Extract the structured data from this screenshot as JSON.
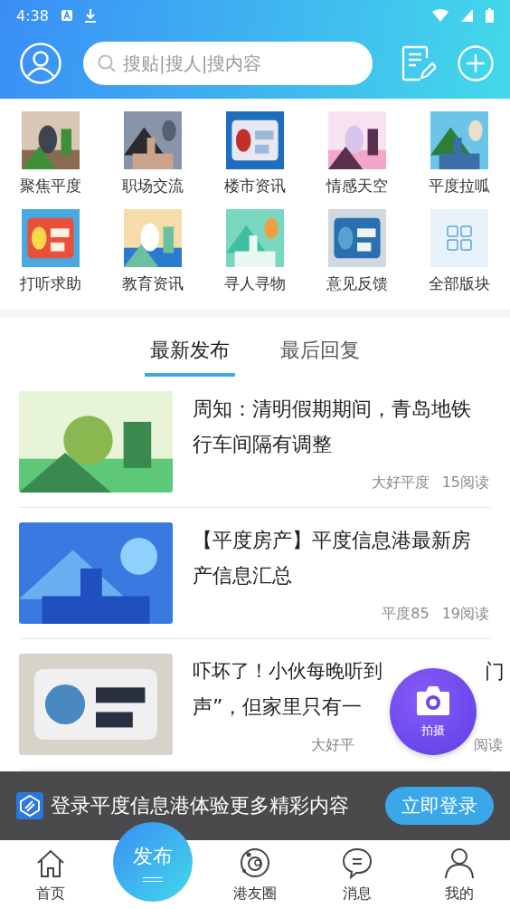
{
  "status_bar": {
    "time": "4:38"
  },
  "header": {
    "search": {
      "placeholder": "搜贴|搜人|搜内容"
    }
  },
  "categories": [
    {
      "label": "聚焦平度",
      "kind": "picture"
    },
    {
      "label": "职场交流",
      "kind": "picture"
    },
    {
      "label": "楼市资讯",
      "kind": "picture"
    },
    {
      "label": "情感天空",
      "kind": "picture"
    },
    {
      "label": "平度拉呱",
      "kind": "picture"
    },
    {
      "label": "打听求助",
      "kind": "picture"
    },
    {
      "label": "教育资讯",
      "kind": "picture"
    },
    {
      "label": "寻人寻物",
      "kind": "picture"
    },
    {
      "label": "意见反馈",
      "kind": "picture"
    },
    {
      "label": "全部版块",
      "kind": "all"
    }
  ],
  "feed_tabs": [
    {
      "label": "最新发布",
      "selected": true
    },
    {
      "label": "最后回复",
      "selected": false
    }
  ],
  "articles": [
    {
      "kind": "full",
      "title": "周知：清明假期期间，青岛地铁行车间隔有调整",
      "author": "大好平度",
      "reads": "15阅读"
    },
    {
      "kind": "full",
      "title": "【平度房产】平度信息港最新房产信息汇总",
      "author": "平度85",
      "reads": "19阅读"
    },
    {
      "kind": "covered",
      "title": "吓坏了！小伙每晚听到",
      "title_end": "门",
      "title_line_2": "声”，但家里只有一",
      "author": "大好平",
      "reads": "阅读"
    }
  ],
  "camera_button": {
    "label": "拍摄"
  },
  "login_banner": {
    "text": "登录平度信息港体验更多精彩内容",
    "button": "立即登录"
  },
  "bottom_nav": [
    {
      "label": "首页",
      "kind": "home"
    },
    {
      "label": "发布",
      "kind": "publish"
    },
    {
      "label": "港友圈",
      "kind": "circle"
    },
    {
      "label": "消息",
      "kind": "message"
    },
    {
      "label": "我的",
      "kind": "profile"
    }
  ]
}
